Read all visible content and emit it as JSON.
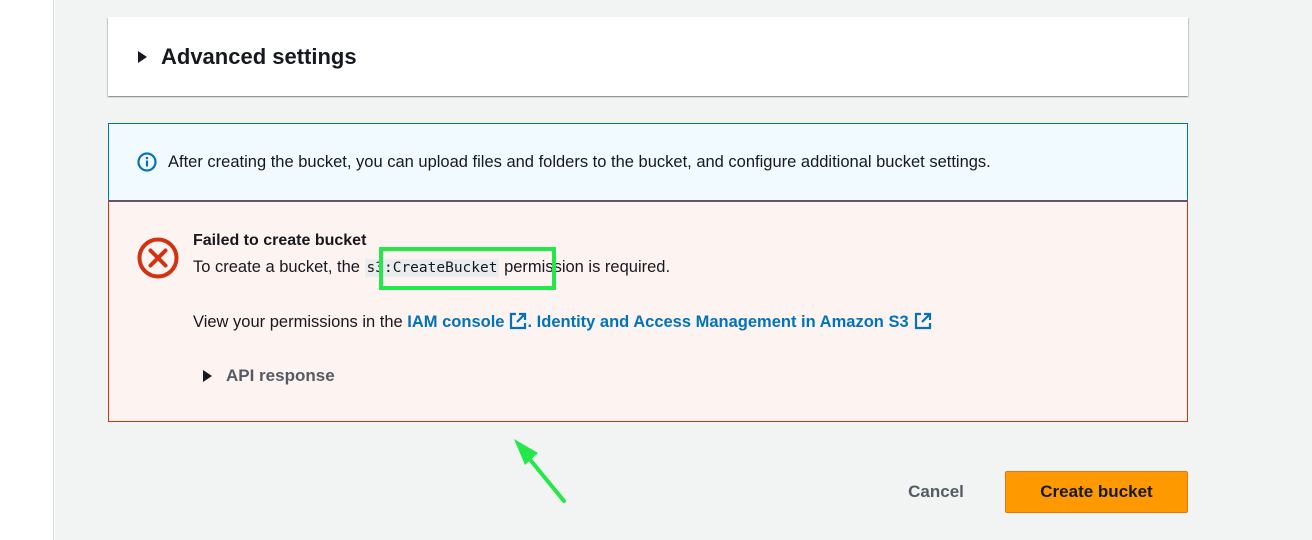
{
  "advanced": {
    "title": "Advanced settings"
  },
  "info": {
    "text": "After creating the bucket, you can upload files and folders to the bucket, and configure additional bucket settings."
  },
  "error": {
    "title": "Failed to create bucket",
    "msg_before": "To create a bucket, the ",
    "code": "s3:CreateBucket",
    "msg_after": " permission is required.",
    "perm_prefix": "View your permissions in the ",
    "iam_link": "IAM console",
    "separator": ".",
    "docs_link": "Identity and Access Management in Amazon S3",
    "api_label": "API response"
  },
  "buttons": {
    "cancel": "Cancel",
    "create": "Create bucket"
  },
  "colors": {
    "info_border": "#0073bb",
    "error_border": "#d13212",
    "primary_button": "#ff9900",
    "annotation": "#22e84a"
  },
  "icons": {
    "info": "info-circle-icon",
    "error": "error-x-circle-icon",
    "external": "external-link-icon",
    "caret": "caret-right-icon"
  }
}
